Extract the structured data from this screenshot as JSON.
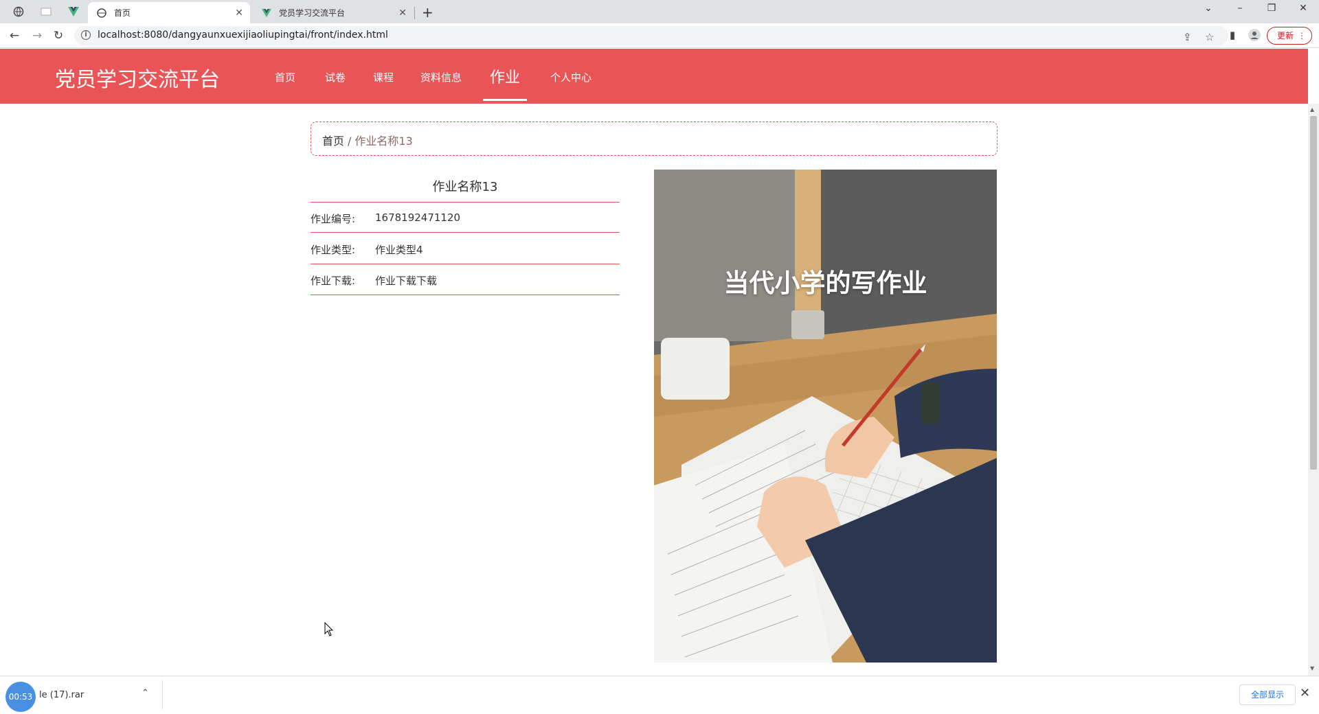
{
  "browser": {
    "tabs": [
      {
        "label": "首页",
        "active": true
      },
      {
        "label": "党员学习交流平台",
        "active": false
      }
    ],
    "url": "localhost:8080/dangyaunxuexijiaoliupingtai/front/index.html",
    "update_label": "更新"
  },
  "site": {
    "title": "党员学习交流平台",
    "nav": [
      {
        "label": "首页"
      },
      {
        "label": "试卷"
      },
      {
        "label": "课程"
      },
      {
        "label": "资料信息"
      },
      {
        "label": "作业",
        "active": true
      },
      {
        "label": "个人中心"
      }
    ],
    "accent_color": "#e95556"
  },
  "breadcrumb": {
    "home": "首页",
    "separator": "/",
    "current": "作业名称13"
  },
  "detail": {
    "title": "作业名称13",
    "rows": [
      {
        "label": "作业编号:",
        "value": "1678192471120"
      },
      {
        "label": "作业类型:",
        "value": "作业类型4"
      },
      {
        "label": "作业下载:",
        "value": "作业下载下载"
      }
    ],
    "image_caption": "当代小学的写作业"
  },
  "download_bar": {
    "timer": "00:53",
    "file_name": "le (17).rar",
    "show_all": "全部显示"
  }
}
